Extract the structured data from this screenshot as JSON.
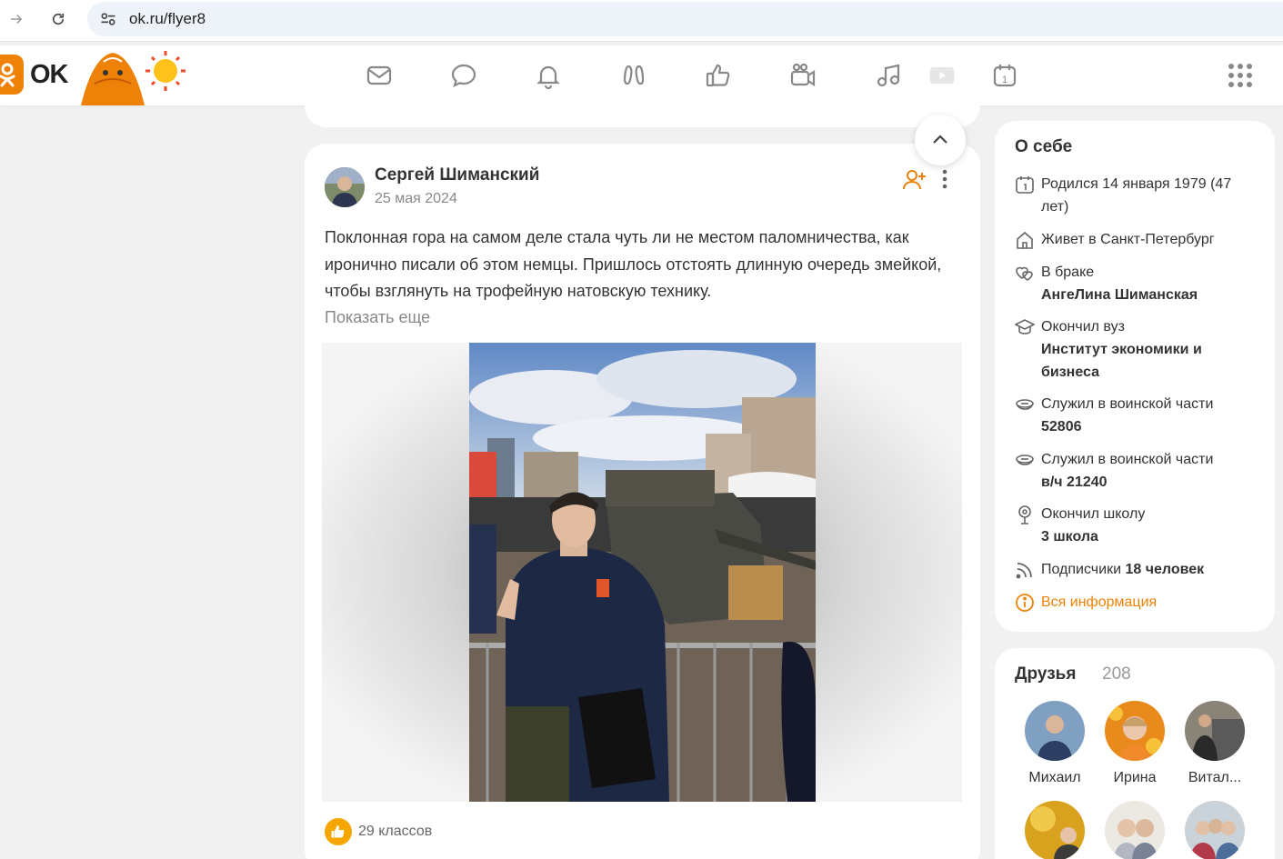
{
  "browser": {
    "url": "ok.ru/flyer8"
  },
  "header": {
    "logo_text": "OK",
    "nav_icons": [
      "mail-icon",
      "chat-icon",
      "bell-icon",
      "guests-icon",
      "like-icon",
      "camera-icon",
      "music-icon",
      "video-icon",
      "calendar-icon"
    ],
    "calendar_day": "1",
    "brand_color": "#ee8208"
  },
  "post": {
    "author": "Сергей Шиманский",
    "date": "25 мая 2024",
    "text": "Поклонная гора на самом деле стала чуть ли не местом паломничества, как иронично писали об этом немцы. Пришлось отстоять длинную очередь змейкой, чтобы взглянуть на трофейную натовскую технику.",
    "show_more": "Показать еще",
    "likes": "29 классов"
  },
  "about": {
    "title": "О себе",
    "born": "Родился 14 января 1979 (47 лет)",
    "lives": "Живет в Санкт-Петербург",
    "married_label": "В браке",
    "married_name": "АнгеЛина Шиманская",
    "university_label": "Окончил вуз",
    "university_name": "Институт экономики и бизнеса",
    "military1_label": "Служил в воинской части",
    "military1_value": "52806",
    "military2_label": "Служил в воинской части",
    "military2_value": "в/ч 21240",
    "school_label": "Окончил школу",
    "school_name": "3 школа",
    "subscribers_label": "Подписчики",
    "subscribers_value": "18 человек",
    "all_info": "Вся информация"
  },
  "friends": {
    "title": "Друзья",
    "count": "208",
    "items": [
      {
        "name": "Михаил"
      },
      {
        "name": "Ирина"
      },
      {
        "name": "Витал..."
      }
    ]
  }
}
